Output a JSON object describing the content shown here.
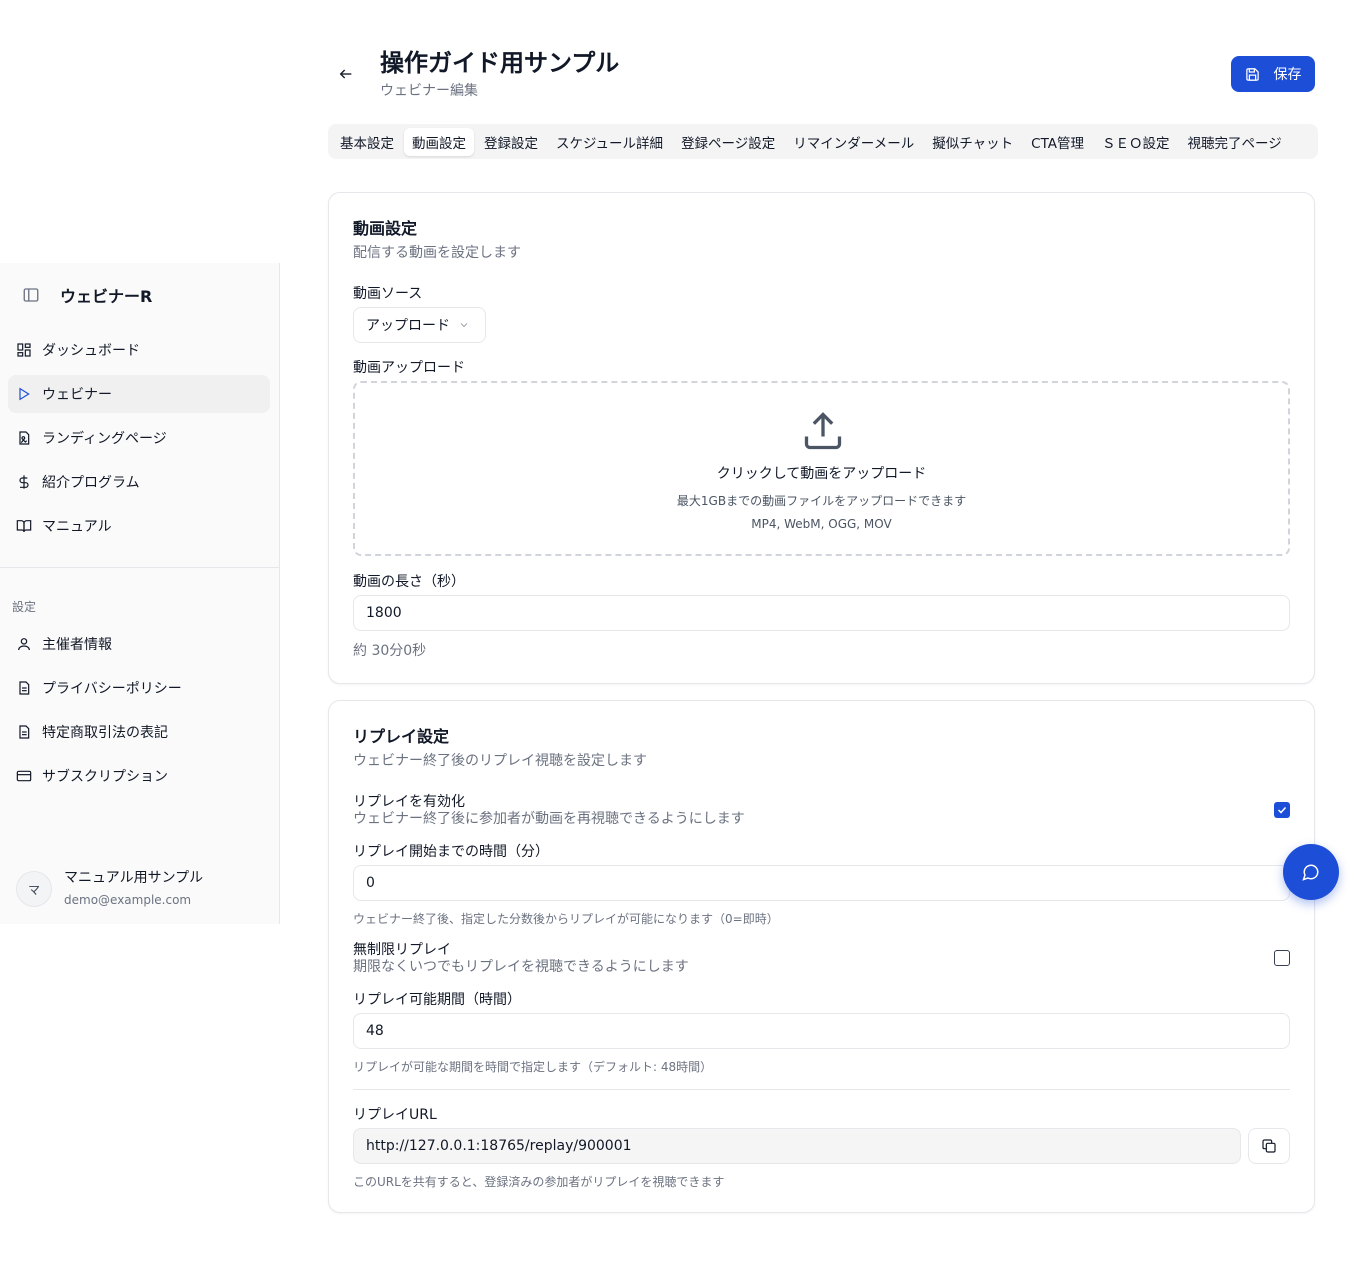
{
  "sidebar": {
    "app_name": "ウェビナーR",
    "nav": [
      {
        "label": "ダッシュボード",
        "icon": "dashboard-icon"
      },
      {
        "label": "ウェビナー",
        "icon": "play-icon"
      },
      {
        "label": "ランディングページ",
        "icon": "landing-page-icon"
      },
      {
        "label": "紹介プログラム",
        "icon": "dollar-icon"
      },
      {
        "label": "マニュアル",
        "icon": "book-icon"
      }
    ],
    "group_label": "設定",
    "settings": [
      {
        "label": "主催者情報",
        "icon": "user-icon"
      },
      {
        "label": "プライバシーポリシー",
        "icon": "document-icon"
      },
      {
        "label": "特定商取引法の表記",
        "icon": "document-icon"
      },
      {
        "label": "サブスクリプション",
        "icon": "credit-card-icon"
      }
    ],
    "user": {
      "initial": "マ",
      "name": "マニュアル用サンプル",
      "email": "demo@example.com"
    }
  },
  "header": {
    "title": "操作ガイド用サンプル",
    "subtitle": "ウェビナー編集",
    "save_label": "保存"
  },
  "tabs": [
    "基本設定",
    "動画設定",
    "登録設定",
    "スケジュール詳細",
    "登録ページ設定",
    "リマインダーメール",
    "擬似チャット",
    "CTA管理",
    "ＳＥＯ設定",
    "視聴完了ページ"
  ],
  "active_tab": "動画設定",
  "video": {
    "title": "動画設定",
    "description": "配信する動画を設定します",
    "source_label": "動画ソース",
    "source_value": "アップロード",
    "upload_label": "動画アップロード",
    "upload_main": "クリックして動画をアップロード",
    "upload_sub": "最大1GBまでの動画ファイルをアップロードできます",
    "upload_formats": "MP4, WebM, OGG, MOV",
    "duration_label": "動画の長さ（秒）",
    "duration_value": "1800",
    "duration_hint": "約 30分0秒"
  },
  "replay": {
    "title": "リプレイ設定",
    "description": "ウェビナー終了後のリプレイ視聴を設定します",
    "enable_label": "リプレイを有効化",
    "enable_desc": "ウェビナー終了後に参加者が動画を再視聴できるようにします",
    "enable_checked": true,
    "delay_label": "リプレイ開始までの時間（分）",
    "delay_value": "0",
    "delay_hint": "ウェビナー終了後、指定した分数後からリプレイが可能になります（0=即時）",
    "unlimited_label": "無制限リプレイ",
    "unlimited_desc": "期限なくいつでもリプレイを視聴できるようにします",
    "unlimited_checked": false,
    "period_label": "リプレイ可能期間（時間）",
    "period_value": "48",
    "period_hint": "リプレイが可能な期間を時間で指定します（デフォルト: 48時間）",
    "url_label": "リプレイURL",
    "url_value": "http://127.0.0.1:18765/replay/900001",
    "url_hint": "このURLを共有すると、登録済みの参加者がリプレイを視聴できます"
  },
  "colors": {
    "accent": "#1d4ed8",
    "muted": "#6b7280",
    "border": "#e5e7eb"
  }
}
